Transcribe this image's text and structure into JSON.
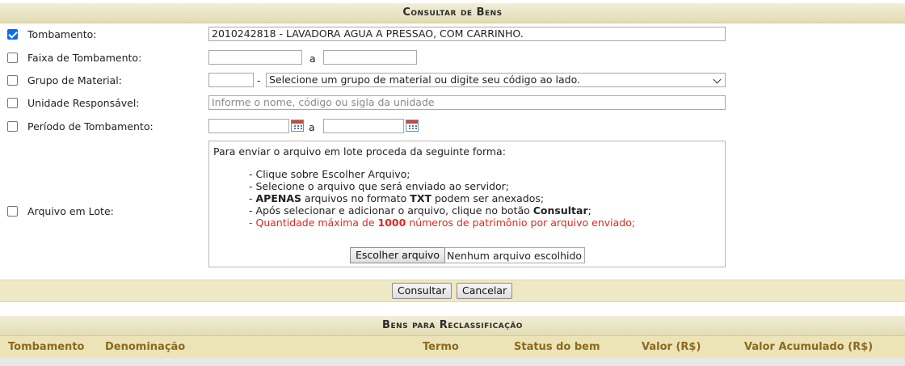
{
  "form": {
    "title": "Consultar de Bens",
    "tombamento": {
      "label": "Tombamento:",
      "value": "2010242818 - LAVADORA AGUA A PRESSAO, COM CARRINHO."
    },
    "faixa": {
      "label": "Faixa de Tombamento:",
      "separator": "a"
    },
    "grupo": {
      "label": "Grupo de Material:",
      "separator": "-",
      "select_value": "Selecione um grupo de material ou digite seu código ao lado."
    },
    "unidade": {
      "label": "Unidade Responsável:",
      "placeholder": "Informe o nome, código ou sigla da unidade"
    },
    "periodo": {
      "label": "Período de Tombamento:",
      "separator": "a"
    },
    "arquivo": {
      "label": "Arquivo em Lote:",
      "intro": "Para enviar o arquivo em lote proceda da seguinte forma:",
      "steps": [
        "- Clique sobre Escolher Arquivo;",
        "- Selecione o arquivo que será enviado ao servidor;",
        {
          "pre": "- ",
          "bold1": "APENAS",
          "mid": " arquivos no formato ",
          "bold2": "TXT",
          "post": " podem ser anexados;"
        },
        {
          "pre": "- Após selecionar e adicionar o arquivo, clique no botão ",
          "bold": "Consultar",
          "post": ";"
        },
        {
          "pre": "- Quantidade máxima de ",
          "bold": "1000",
          "post": " números de patrimônio por arquivo enviado;"
        }
      ],
      "choose_button": "Escolher arquivo",
      "file_status": "Nenhum arquivo escolhido"
    },
    "buttons": {
      "consultar": "Consultar",
      "cancelar": "Cancelar"
    }
  },
  "results": {
    "title": "Bens para Reclassificação",
    "columns": [
      "Tombamento",
      "Denominação",
      "Termo",
      "Status do bem",
      "Valor (R$)",
      "Valor Acumulado (R$)"
    ]
  },
  "colors": {
    "header_bg": "#e2dcb4",
    "column_header_text": "#8a6a1f",
    "warning_red": "#e2261c",
    "checkbox_checked": "#0b6ee8"
  }
}
